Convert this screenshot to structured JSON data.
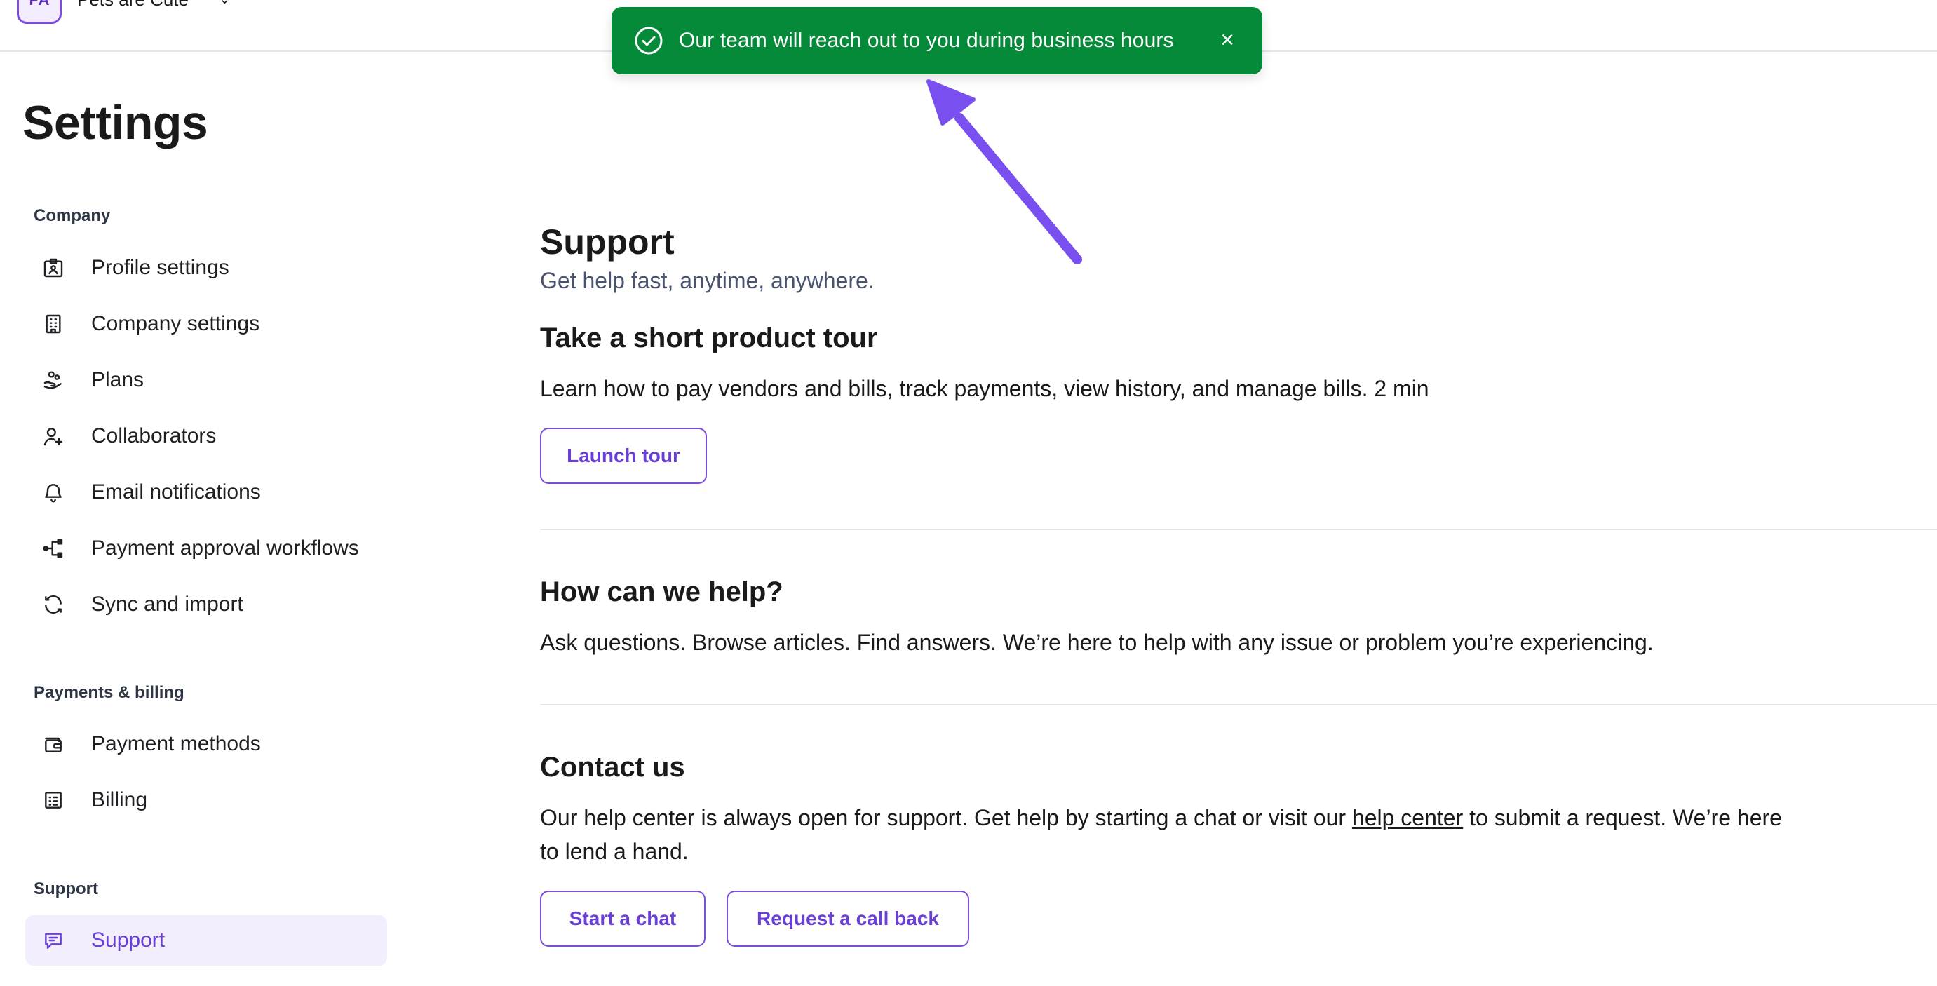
{
  "header": {
    "avatar_initials": "PA",
    "company_name": "Pets are Cute",
    "company_caret": "⌄"
  },
  "toast": {
    "message": "Our team will reach out to you during business hours",
    "close_label": "×",
    "color": "#058a3a"
  },
  "sidebar": {
    "title": "Settings",
    "sections": [
      {
        "label": "Company",
        "items": [
          {
            "label": "Profile settings",
            "icon": "id-card-icon"
          },
          {
            "label": "Company settings",
            "icon": "building-icon"
          },
          {
            "label": "Plans",
            "icon": "hand-coins-icon"
          },
          {
            "label": "Collaborators",
            "icon": "user-plus-icon"
          },
          {
            "label": "Email notifications",
            "icon": "bell-icon"
          },
          {
            "label": "Payment approval workflows",
            "icon": "workflow-icon"
          },
          {
            "label": "Sync and import",
            "icon": "sync-icon"
          }
        ]
      },
      {
        "label": "Payments & billing",
        "items": [
          {
            "label": "Payment methods",
            "icon": "wallet-icon"
          },
          {
            "label": "Billing",
            "icon": "receipt-icon"
          }
        ]
      },
      {
        "label": "Support",
        "items": [
          {
            "label": "Support",
            "icon": "chat-icon",
            "active": true
          }
        ]
      }
    ]
  },
  "main": {
    "title": "Support",
    "subtitle": "Get help fast, anytime, anywhere.",
    "tour": {
      "heading": "Take a short product tour",
      "text": "Learn how to pay vendors and bills, track payments, view history, and manage bills. 2 min",
      "button": "Launch tour"
    },
    "help": {
      "heading": "How can we help?",
      "text": "Ask questions. Browse articles. Find answers. We’re here to help with any issue or problem you’re experiencing."
    },
    "contact": {
      "heading": "Contact us",
      "text_before": "Our help center is always open for support. Get help by starting a chat or visit our ",
      "link": "help center",
      "text_after": " to submit a request. We’re here",
      "text_line2": "to lend a hand.",
      "chat_button": "Start a chat",
      "callback_button": "Request a call back"
    }
  },
  "colors": {
    "accent": "#7c4ddb",
    "accent_text": "#6a3fd6",
    "active_bg": "#f3eefe",
    "annotation_arrow": "#7a4ff0"
  }
}
